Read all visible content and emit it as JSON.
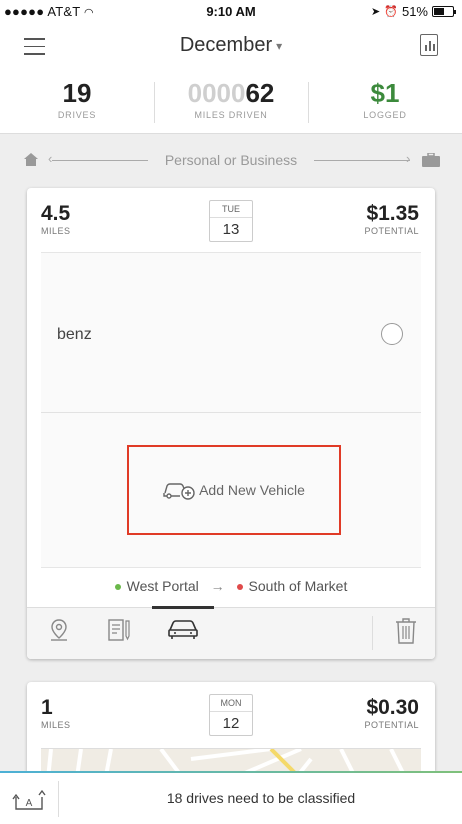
{
  "status_bar": {
    "carrier": "●●●●● AT&T",
    "time": "9:10 AM",
    "battery": "51%"
  },
  "header": {
    "month": "December",
    "caret": "▾"
  },
  "stats": [
    {
      "dim": "",
      "value": "19",
      "label": "DRIVES"
    },
    {
      "dim": "0000",
      "value": "62",
      "label": "MILES DRIVEN"
    },
    {
      "dim": "",
      "value": "$1",
      "label": "LOGGED"
    }
  ],
  "classify": {
    "label": "Personal or Business"
  },
  "cards": [
    {
      "miles": "4.5",
      "miles_label": "MILES",
      "dow": "TUE",
      "day": "13",
      "potential": "$1.35",
      "potential_label": "POTENTIAL",
      "vehicle_name": "benz",
      "add_vehicle_label": "Add New Vehicle",
      "route_from": "West Portal",
      "route_arrow": "→",
      "route_to": "South of Market"
    },
    {
      "miles": "1",
      "miles_label": "MILES",
      "dow": "MON",
      "day": "12",
      "potential": "$0.30",
      "potential_label": "POTENTIAL"
    }
  ],
  "bottom_bar": {
    "message": "18 drives need to be classified"
  },
  "colors": {
    "green": "#3c8a3c",
    "highlight": "#e03a26",
    "route_from_dot": "#6ab84a",
    "route_to_dot": "#e04a4a"
  },
  "icons": [
    "menu-icon",
    "report-icon",
    "house-icon",
    "briefcase-icon",
    "location-pin-icon",
    "notes-icon",
    "car-icon",
    "trash-icon",
    "add-car-icon",
    "auto-classify-icon"
  ]
}
